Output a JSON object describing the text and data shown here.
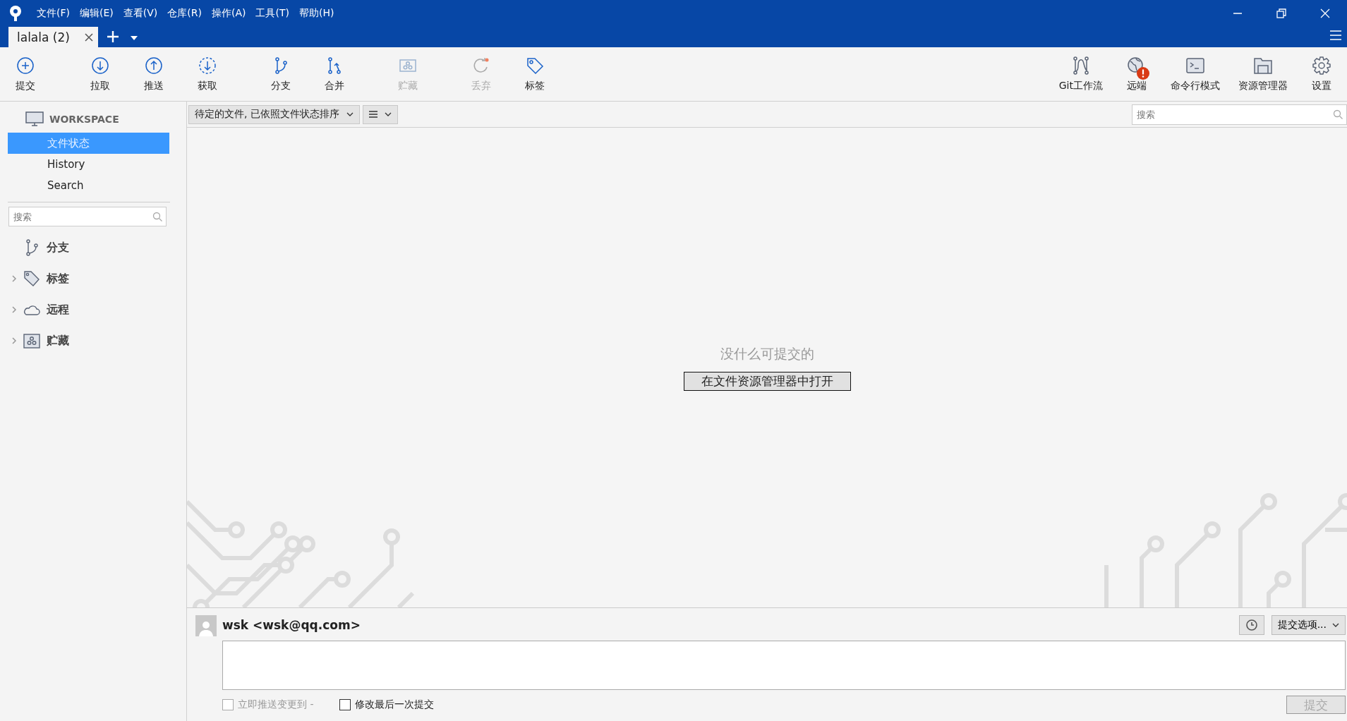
{
  "menu": [
    "文件(F)",
    "编辑(E)",
    "查看(V)",
    "仓库(R)",
    "操作(A)",
    "工具(T)",
    "帮助(H)"
  ],
  "tabs": [
    {
      "label": "lalala (2)",
      "selected": true
    }
  ],
  "toolbar_left": [
    {
      "kind": "commit",
      "label": "提交",
      "disabled": false
    },
    {
      "kind": "pull",
      "label": "拉取",
      "disabled": false
    },
    {
      "kind": "push",
      "label": "推送",
      "disabled": false
    },
    {
      "kind": "fetch",
      "label": "获取",
      "disabled": false
    },
    {
      "kind": "branch",
      "label": "分支",
      "disabled": false
    },
    {
      "kind": "merge",
      "label": "合并",
      "disabled": false
    },
    {
      "kind": "stash",
      "label": "贮藏",
      "disabled": true
    },
    {
      "kind": "discard",
      "label": "丢弃",
      "disabled": true
    },
    {
      "kind": "tag",
      "label": "标签",
      "disabled": false
    }
  ],
  "toolbar_right": [
    {
      "kind": "flow",
      "label": "Git工作流",
      "alert": false
    },
    {
      "kind": "remote",
      "label": "远端",
      "alert": true
    },
    {
      "kind": "terminal",
      "label": "命令行模式",
      "alert": false
    },
    {
      "kind": "explorer",
      "label": "资源管理器",
      "alert": false
    },
    {
      "kind": "settings",
      "label": "设置",
      "alert": false
    }
  ],
  "sidebar": {
    "workspace": "WORKSPACE",
    "items": [
      {
        "label": "文件状态",
        "selected": true
      },
      {
        "label": "History",
        "selected": false
      },
      {
        "label": "Search",
        "selected": false
      }
    ],
    "search": {
      "placeholder": "搜索"
    },
    "sections": [
      {
        "kind": "branch",
        "label": "分支",
        "expandable": false
      },
      {
        "kind": "tag",
        "label": "标签",
        "expandable": true
      },
      {
        "kind": "remote",
        "label": "远程",
        "expandable": true
      },
      {
        "kind": "stash",
        "label": "贮藏",
        "expandable": true
      }
    ]
  },
  "filter": {
    "sort": "待定的文件, 已依照文件状态排序",
    "search": {
      "placeholder": "搜索"
    }
  },
  "empty": {
    "message": "没什么可提交的",
    "button": "在文件资源管理器中打开"
  },
  "commit": {
    "author": "wsk <wsk@qq.com>",
    "options": "提交选项...",
    "checkboxes": [
      {
        "label": "立即推送变更到 -",
        "checked": false,
        "disabled": true
      },
      {
        "label": "修改最后一次提交",
        "checked": false,
        "disabled": false
      }
    ],
    "submit": {
      "label": "提交",
      "disabled": true
    }
  }
}
